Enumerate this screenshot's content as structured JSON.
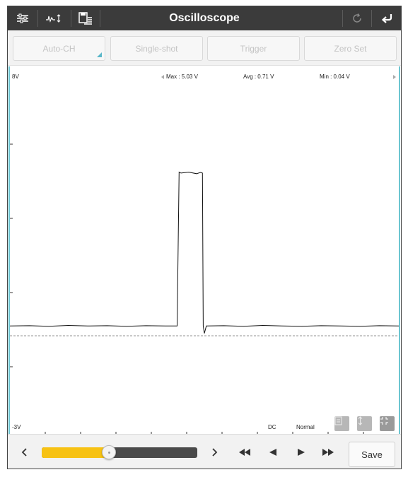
{
  "app": {
    "title": "Oscilloscope"
  },
  "toolbar": {
    "left_icons": [
      "settings-sliders-icon",
      "waveform-icon",
      "save-list-icon"
    ],
    "right_icons": [
      "refresh-icon",
      "back-arrow-icon"
    ]
  },
  "mode_buttons": [
    {
      "label": "Auto-CH",
      "has_dropdown": true
    },
    {
      "label": "Single-shot"
    },
    {
      "label": "Trigger"
    },
    {
      "label": "Zero Set"
    }
  ],
  "scope": {
    "top_scale": "8V",
    "bottom_scale": "-3V",
    "max_label": "Max : 5.03 V",
    "avg_label": "Avg : 0.71 V",
    "min_label": "Min : 0.04 V",
    "coupling": "DC",
    "mode": "Normal",
    "trace_color": "#111111",
    "border_color": "#6cc5d1",
    "tool_icons": [
      "document-icon",
      "vertical-arrows-icon",
      "collapse-icon"
    ]
  },
  "chart_data": {
    "type": "line",
    "ylim": [
      -3,
      8
    ],
    "series": [
      {
        "values_description_none": "",
        "points": [
          [
            0,
            0.04
          ],
          [
            0.05,
            0.05
          ],
          [
            0.1,
            0.03
          ],
          [
            0.15,
            0.06
          ],
          [
            0.2,
            0.04
          ],
          [
            0.25,
            0.05
          ],
          [
            0.3,
            0.03
          ],
          [
            0.35,
            0.05
          ],
          [
            0.4,
            0.04
          ],
          [
            0.43,
            0.04
          ],
          [
            0.435,
            5.03
          ],
          [
            0.44,
            5.0
          ],
          [
            0.46,
            5.03
          ],
          [
            0.48,
            4.98
          ],
          [
            0.49,
            5.02
          ],
          [
            0.495,
            5.0
          ],
          [
            0.497,
            0.04
          ],
          [
            0.5,
            -0.2
          ],
          [
            0.505,
            0.04
          ],
          [
            0.55,
            0.05
          ],
          [
            0.6,
            0.03
          ],
          [
            0.65,
            0.06
          ],
          [
            0.7,
            0.04
          ],
          [
            0.75,
            0.03
          ],
          [
            0.8,
            0.05
          ],
          [
            0.85,
            0.04
          ],
          [
            0.9,
            0.03
          ],
          [
            0.95,
            0.05
          ],
          [
            1.0,
            0.04
          ]
        ]
      }
    ]
  },
  "bottom": {
    "slider_fraction": 0.43,
    "save_label": "Save",
    "nav_icons": [
      "chevron-left-icon",
      "chevron-right-icon",
      "rewind-icon",
      "step-back-icon",
      "step-forward-icon",
      "fast-forward-icon"
    ],
    "accent_color": "#f7c213"
  }
}
